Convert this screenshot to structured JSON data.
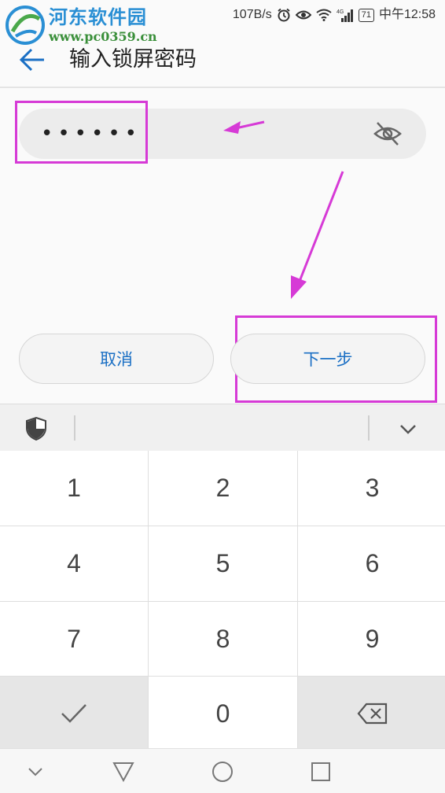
{
  "watermark": {
    "title": "河东软件园",
    "url": "www.pc0359.cn"
  },
  "status_bar": {
    "network_speed": "107B/s",
    "battery": "71",
    "time": "中午12:58",
    "icons": [
      "alarm-icon",
      "eye-comfort-icon",
      "wifi-icon",
      "signal-4g-icon",
      "battery-icon"
    ]
  },
  "header": {
    "title": "输入锁屏密码",
    "back_icon": "back-arrow-icon"
  },
  "password_field": {
    "value": "••••••",
    "visibility_icon": "eye-hidden-icon"
  },
  "buttons": {
    "cancel": "取消",
    "next": "下一步"
  },
  "keyboard_toolbar": {
    "left_icon": "shield-icon",
    "right_icon": "chevron-down-icon"
  },
  "keypad": {
    "keys": [
      "1",
      "2",
      "3",
      "4",
      "5",
      "6",
      "7",
      "8",
      "9"
    ],
    "bottom": {
      "confirm_icon": "checkmark-icon",
      "zero": "0",
      "delete_icon": "backspace-icon"
    }
  },
  "nav_bar": {
    "icons": [
      "hide-nav-icon",
      "back-triangle-icon",
      "home-circle-icon",
      "recents-square-icon"
    ]
  },
  "annotations": {
    "color": "#d63ad6"
  },
  "colors": {
    "accent": "#1a6fc4",
    "title": "#2a8fd4"
  }
}
